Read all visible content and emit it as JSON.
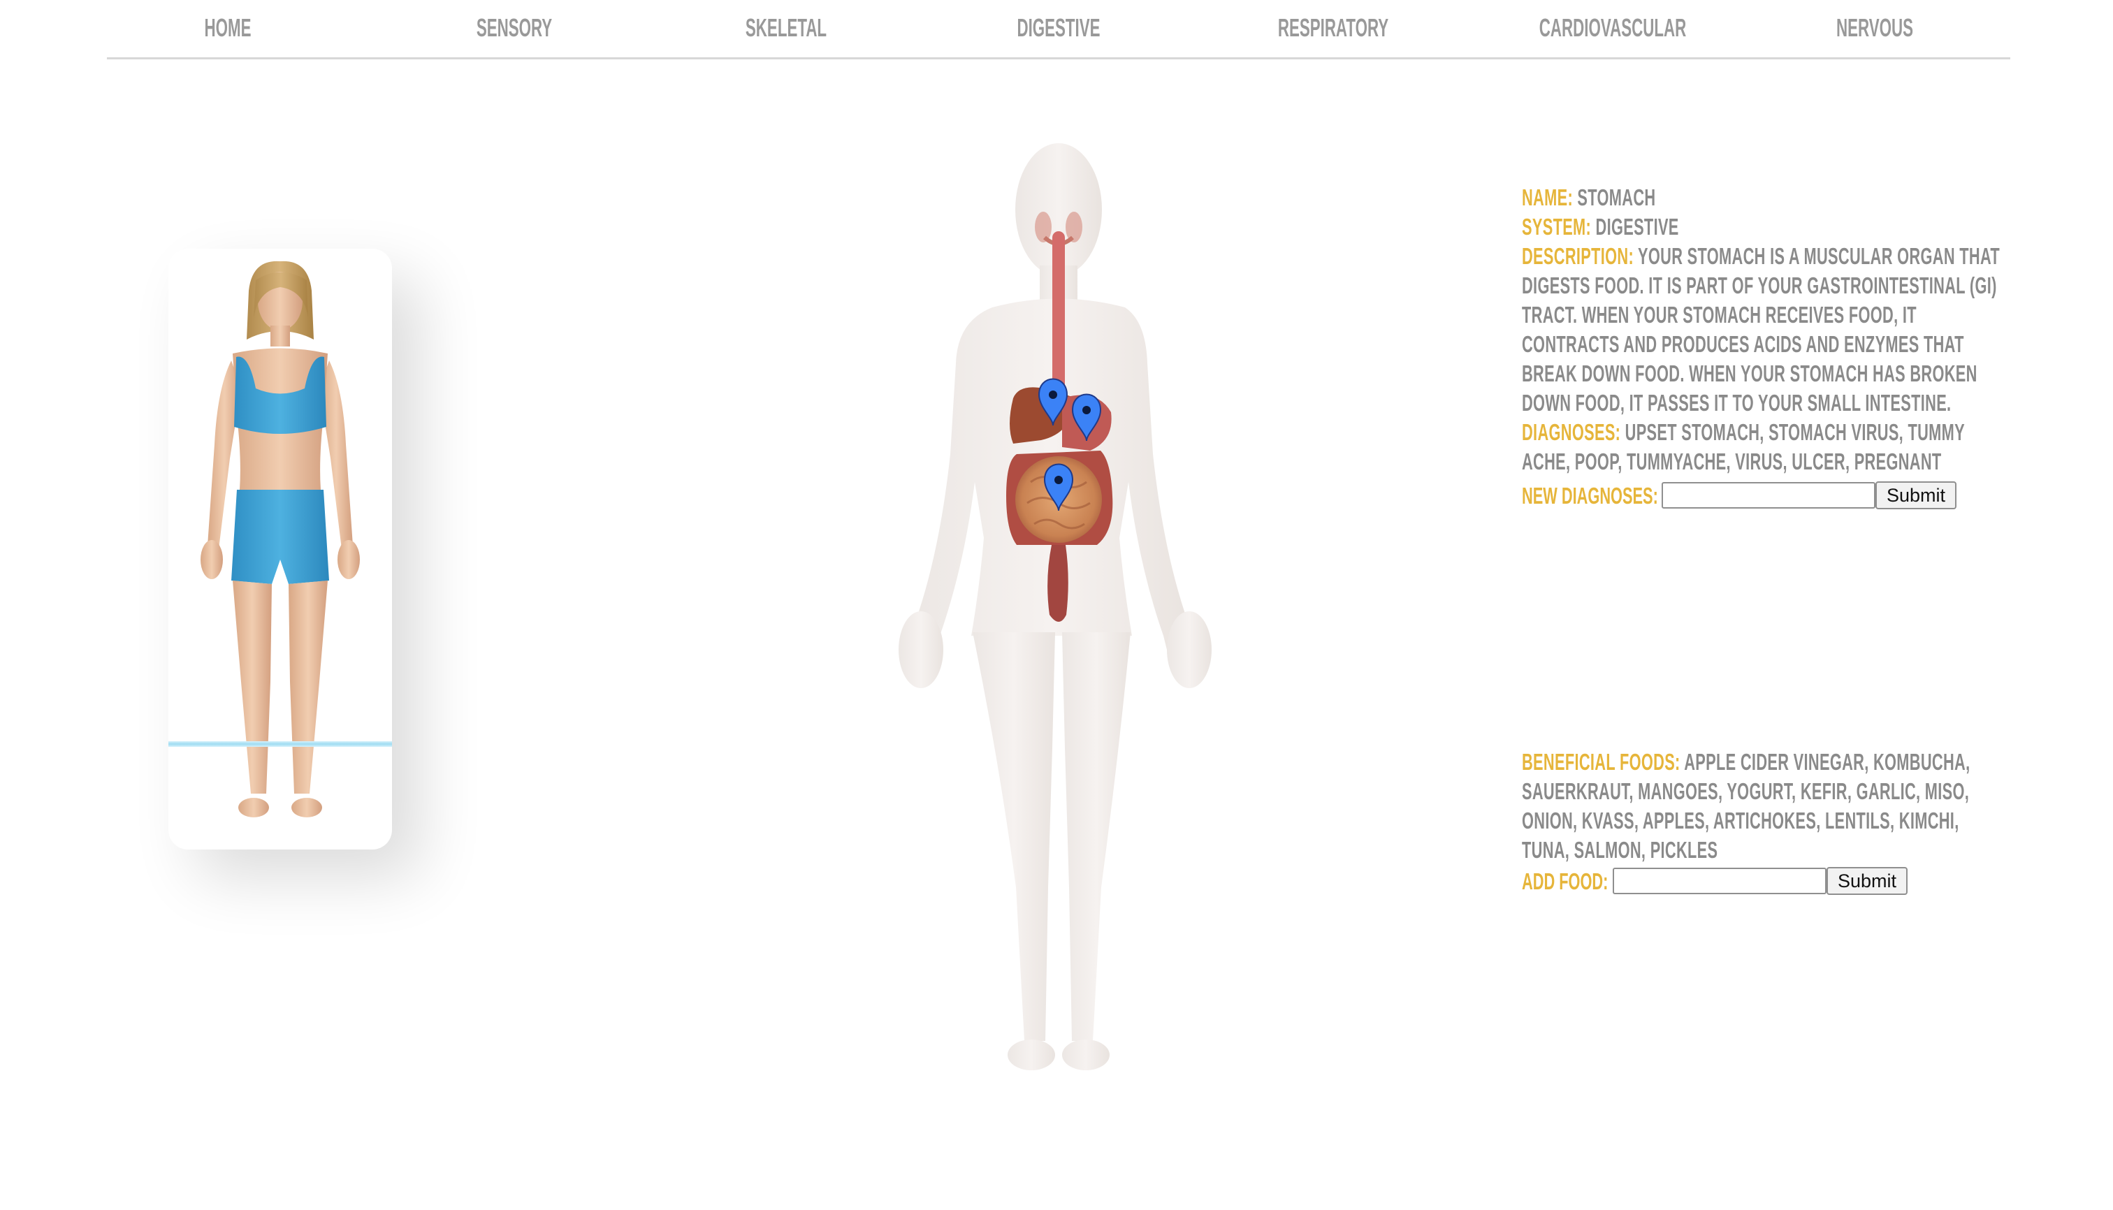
{
  "nav": {
    "items": [
      {
        "label": "HOME"
      },
      {
        "label": "SENSORY"
      },
      {
        "label": "SKELETAL"
      },
      {
        "label": "DIGESTIVE"
      },
      {
        "label": "RESPIRATORY"
      },
      {
        "label": "CARDIOVASCULAR"
      },
      {
        "label": "NERVOUS"
      }
    ]
  },
  "organ": {
    "name_label": "NAME:",
    "name": "STOMACH",
    "system_label": "SYSTEM:",
    "system": "DIGESTIVE",
    "description_label": "DESCRIPTION:",
    "description": "YOUR STOMACH IS A MUSCULAR ORGAN THAT DIGESTS FOOD. IT IS PART OF YOUR GASTROINTESTINAL (GI) TRACT. WHEN YOUR STOMACH RECEIVES FOOD, IT CONTRACTS AND PRODUCES ACIDS AND ENZYMES THAT BREAK DOWN FOOD. WHEN YOUR STOMACH HAS BROKEN DOWN FOOD, IT PASSES IT TO YOUR SMALL INTESTINE.",
    "diagnoses_label": "DIAGNOSES:",
    "diagnoses": "UPSET STOMACH, STOMACH VIRUS, TUMMY ACHE, POOP, TUMMYACHE, VIRUS, ULCER, PREGNANT",
    "new_diagnoses_label": "NEW DIAGNOSES:",
    "new_diagnoses_value": "",
    "submit_label": "Submit"
  },
  "foods": {
    "beneficial_label": "BENEFICIAL FOODS:",
    "beneficial": "APPLE CIDER VINEGAR, KOMBUCHA, SAUERKRAUT, MANGOES, YOGURT, KEFIR, GARLIC, MISO, ONION, KVASS, APPLES, ARTICHOKES, LENTILS, KIMCHI, TUNA, SALMON, PICKLES",
    "add_label": "ADD FOOD:",
    "add_value": "",
    "submit_label": "Submit"
  },
  "colors": {
    "label_accent": "#e6b53a",
    "text_gray": "#8a8a8a",
    "marker_blue": "#3b82f6"
  },
  "icons": {
    "marker": "map-pin-icon"
  }
}
